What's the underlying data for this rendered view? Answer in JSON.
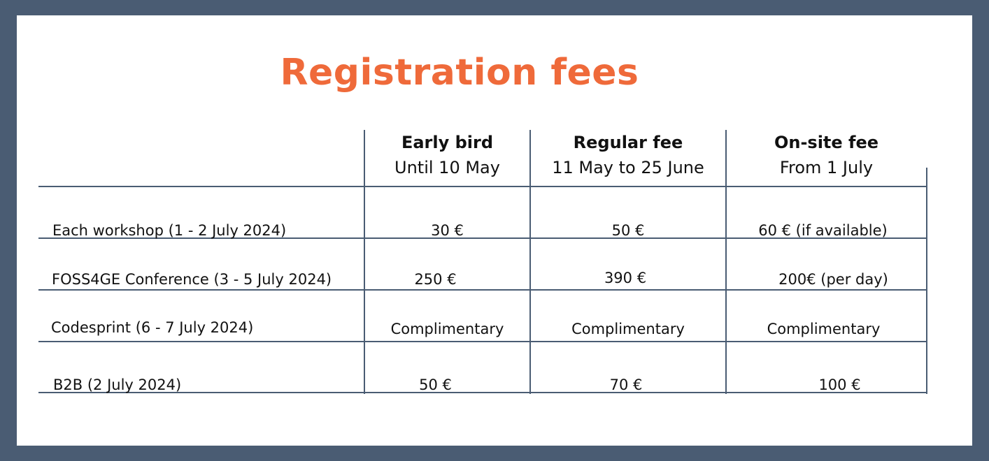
{
  "title": "Registration fees",
  "columns": [
    {
      "title": "Early bird",
      "subtitle": "Until 10 May"
    },
    {
      "title": "Regular fee",
      "subtitle": "11 May to 25 June"
    },
    {
      "title": "On-site fee",
      "subtitle": "From 1 July"
    }
  ],
  "rows": [
    {
      "label": "Each workshop (1 - 2 July 2024)",
      "values": [
        "30 €",
        "50 €",
        "60 € (if available)"
      ]
    },
    {
      "label": "FOSS4GE Conference (3 - 5 July 2024)",
      "values": [
        "250 €",
        "390 €",
        "200€ (per day)"
      ]
    },
    {
      "label": "Codesprint (6 - 7 July 2024)",
      "values": [
        "Complimentary",
        "Complimentary",
        "Complimentary"
      ]
    },
    {
      "label": "B2B (2 July 2024)",
      "values": [
        "50 €",
        "70 €",
        "100 €"
      ]
    }
  ],
  "colors": {
    "border": "#4a5c73",
    "title": "#ef6a3a",
    "background": "#ffffff"
  }
}
